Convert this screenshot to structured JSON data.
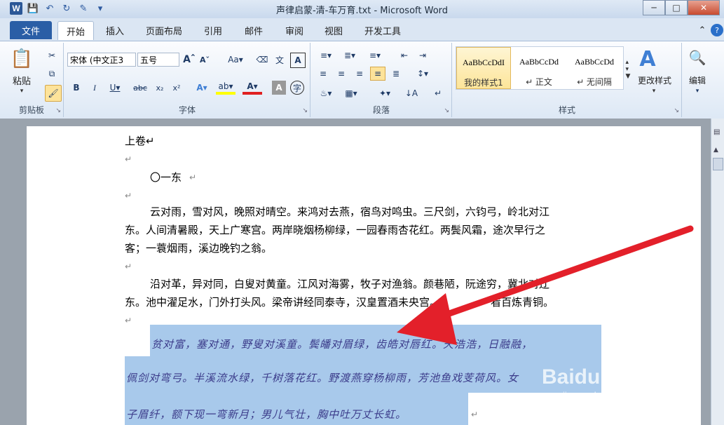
{
  "window": {
    "title": "声律启蒙-清-车万育.txt - Microsoft Word"
  },
  "tabs": [
    "文件",
    "开始",
    "插入",
    "页面布局",
    "引用",
    "邮件",
    "审阅",
    "视图",
    "开发工具"
  ],
  "font": {
    "name": "宋体 (中文正3",
    "size": "五号"
  },
  "groups": {
    "clipboard": "剪贴板",
    "font": "字体",
    "paragraph": "段落",
    "styles": "样式"
  },
  "clipboard": {
    "paste": "粘贴"
  },
  "styles": [
    {
      "preview": "AaBbCcDdI",
      "name": "我的样式1"
    },
    {
      "preview": "AaBbCcDd",
      "name": "↵ 正文"
    },
    {
      "preview": "AaBbCcDd",
      "name": "↵ 无间隔"
    }
  ],
  "change_styles": "更改样式",
  "edit": "编辑",
  "document": {
    "heading": "上卷↵",
    "section": "〇一东",
    "p1": [
      "云对雨，雪对风，晚照对晴空。来鸿对去燕，宿鸟对鸣虫。三尺剑，六钧弓，岭北对江",
      "东。人间清暑殿，天上广寒宫。两岸晓烟杨柳绿，一园春雨杏花红。两鬓风霜，途次早行之",
      "客；一蓑烟雨，溪边晚钓之翁。"
    ],
    "p2": [
      "沿对革，异对同，白叟对黄童。江风对海雾，牧子对渔翁。颜巷陋，阮途穷，冀北对辽",
      "东。池中濯足水，门外打头风。梁帝讲经同泰寺，汉皇置酒未央宫。尘虑萦心，懒抚七弦绿",
      "绮；霜华满鬓，羞看百炼青铜。"
    ],
    "p2_visible": [
      "沿对革，异对同，白叟对黄童。江风对海雾，牧子对渔翁。颜巷陋，阮途穷，冀北对辽",
      "东。池中濯足水，门外打头风。梁帝讲经同泰寺，汉皇置酒未央宫。",
      "看百炼青铜。"
    ],
    "p3": [
      "贫对富，塞对通，野叟对溪童。鬓皤对眉绿，齿皓对唇红。天浩浩，日融融，",
      "佩剑对弯弓。半溪流水绿，千树落花红。野渡燕穿杨柳雨，芳池鱼戏芰荷风。女",
      "子眉纤，额下现一弯新月；男儿气壮，胸中吐万丈长虹。"
    ]
  },
  "watermark": {
    "brand": "Baidu 经验",
    "url": "jingyan.baidu.com"
  },
  "colors": {
    "accent": "#2a5ea6",
    "highlight": "#a8c9eb",
    "arrow": "#e3202a"
  }
}
